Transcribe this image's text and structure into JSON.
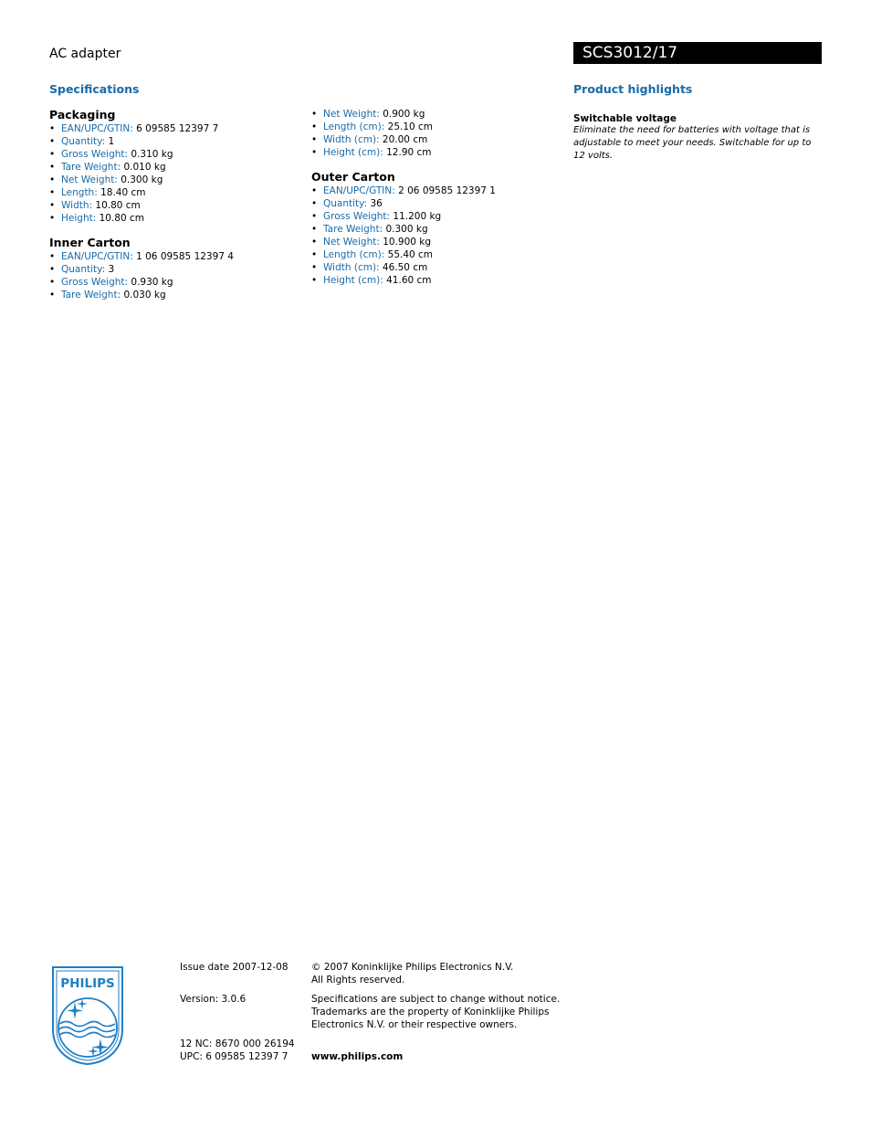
{
  "header": {
    "product_type": "AC adapter",
    "model": "SCS3012/17"
  },
  "specifications": {
    "title": "Specifications",
    "groups": [
      {
        "title": "Packaging",
        "items": [
          {
            "label": "EAN/UPC/GTIN:",
            "value": "6 09585 12397 7"
          },
          {
            "label": "Quantity:",
            "value": "1"
          },
          {
            "label": "Gross Weight:",
            "value": "0.310 kg"
          },
          {
            "label": "Tare Weight:",
            "value": "0.010 kg"
          },
          {
            "label": "Net Weight:",
            "value": "0.300 kg"
          },
          {
            "label": "Length:",
            "value": "18.40 cm"
          },
          {
            "label": "Width:",
            "value": "10.80 cm"
          },
          {
            "label": "Height:",
            "value": "10.80 cm"
          }
        ]
      },
      {
        "title": "Inner Carton",
        "items": [
          {
            "label": "EAN/UPC/GTIN:",
            "value": "1 06 09585 12397 4"
          },
          {
            "label": "Quantity:",
            "value": "3"
          },
          {
            "label": "Gross Weight:",
            "value": "0.930 kg"
          },
          {
            "label": "Tare Weight:",
            "value": "0.030 kg"
          },
          {
            "label": "Net Weight:",
            "value": "0.900 kg"
          },
          {
            "label": "Length (cm):",
            "value": "25.10 cm"
          },
          {
            "label": "Width (cm):",
            "value": "20.00 cm"
          },
          {
            "label": "Height (cm):",
            "value": "12.90 cm"
          }
        ]
      },
      {
        "title": "Outer Carton",
        "items": [
          {
            "label": "EAN/UPC/GTIN:",
            "value": "2 06 09585 12397 1"
          },
          {
            "label": "Quantity:",
            "value": "36"
          },
          {
            "label": "Gross Weight:",
            "value": "11.200 kg"
          },
          {
            "label": "Tare Weight:",
            "value": "0.300 kg"
          },
          {
            "label": "Net Weight:",
            "value": "10.900 kg"
          },
          {
            "label": "Length (cm):",
            "value": "55.40 cm"
          },
          {
            "label": "Width (cm):",
            "value": "46.50 cm"
          },
          {
            "label": "Height (cm):",
            "value": "41.60 cm"
          }
        ]
      }
    ]
  },
  "highlights": {
    "title": "Product highlights",
    "items": [
      {
        "title": "Switchable voltage",
        "body": "Eliminate the need for batteries with voltage that is adjustable to meet your needs. Switchable for up to 12 volts."
      }
    ]
  },
  "footer": {
    "logo_text": "PHILIPS",
    "issue_date": "Issue date 2007-12-08",
    "version": "Version: 3.0.6",
    "nc": "12 NC: 8670 000 26194",
    "upc": "UPC: 6 09585 12397 7",
    "copyright_line1": "© 2007 Koninklijke Philips Electronics N.V.",
    "copyright_line2": "All Rights reserved.",
    "notice_line1": "Specifications are subject to change without notice.",
    "notice_line2": "Trademarks are the property of Koninklijke Philips",
    "notice_line3": "Electronics N.V. or their respective owners.",
    "website": "www.philips.com"
  },
  "colors": {
    "accent": "#1a6aa7",
    "logo_blue": "#1f7fc4"
  }
}
